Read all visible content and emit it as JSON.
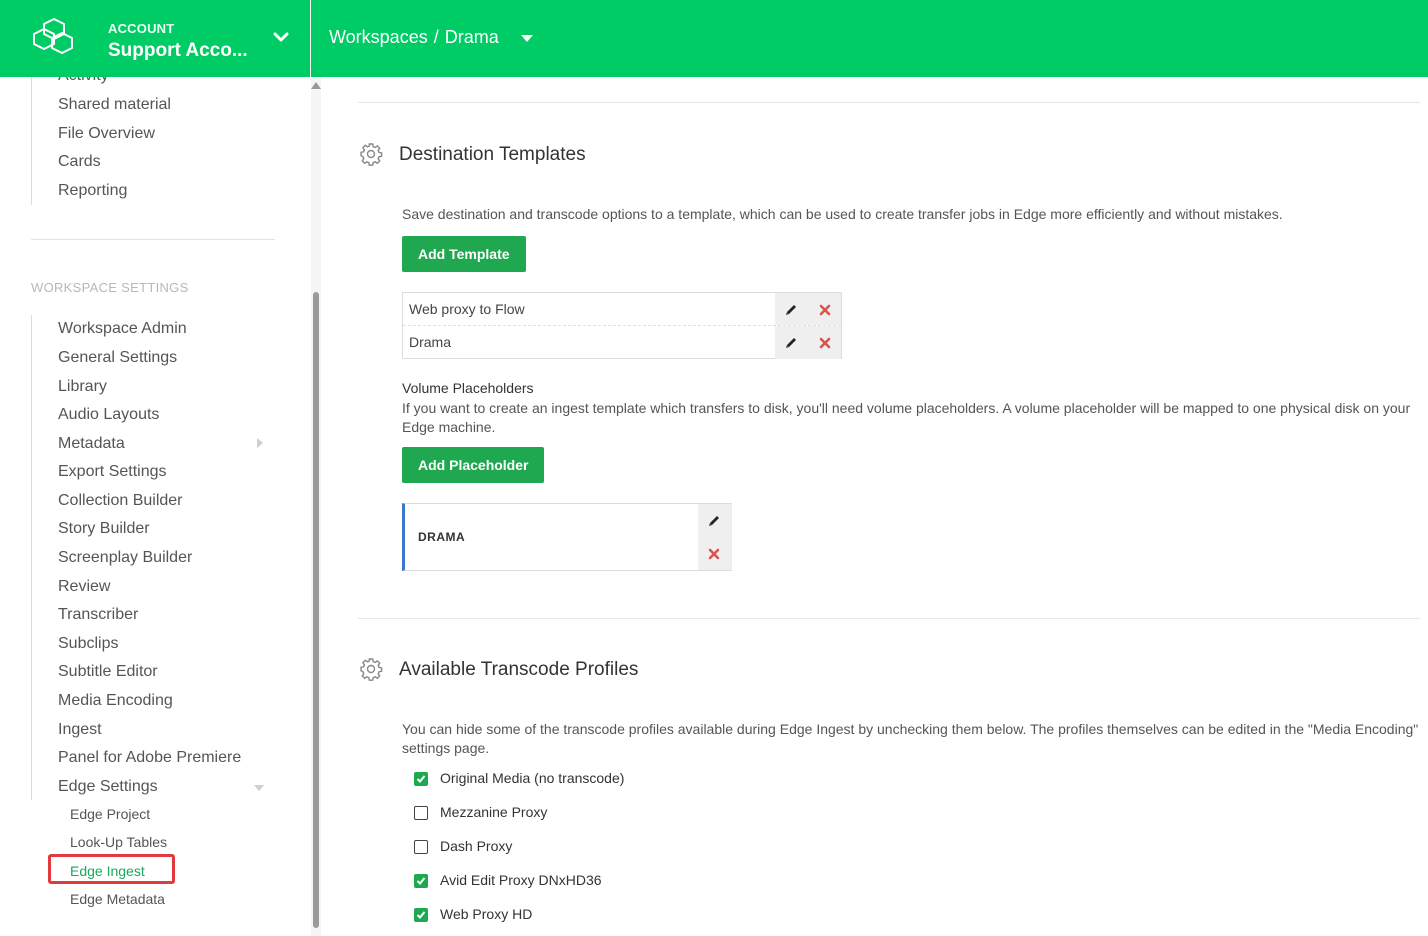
{
  "header": {
    "account_label": "ACCOUNT",
    "account_name": "Support Acco...",
    "breadcrumb_root": "Workspaces",
    "breadcrumb_sep": "/",
    "breadcrumb_current": "Drama"
  },
  "sidebar": {
    "top_items": [
      "Activity",
      "Shared material",
      "File Overview",
      "Cards",
      "Reporting"
    ],
    "section_heading": "WORKSPACE SETTINGS",
    "items": [
      "Workspace Admin",
      "General Settings",
      "Library",
      "Audio Layouts",
      "Metadata",
      "Export Settings",
      "Collection Builder",
      "Story Builder",
      "Screenplay Builder",
      "Review",
      "Transcriber",
      "Subclips",
      "Subtitle Editor",
      "Media Encoding",
      "Ingest",
      "Panel for Adobe Premiere",
      "Edge Settings"
    ],
    "sub_items": [
      "Edge Project",
      "Look-Up Tables",
      "Edge Ingest",
      "Edge Metadata"
    ],
    "active_sub_item": "Edge Ingest"
  },
  "destination_templates": {
    "title": "Destination Templates",
    "description": "Save destination and transcode options to a template, which can be used to create transfer jobs in Edge more efficiently and without mistakes.",
    "add_button": "Add Template",
    "templates": [
      "Web proxy to Flow",
      "Drama"
    ],
    "volume_title": "Volume Placeholders",
    "volume_description": "If you want to create an ingest template which transfers to disk, you'll need volume placeholders. A volume placeholder will be mapped to one physical disk on your Edge machine.",
    "add_placeholder_button": "Add Placeholder",
    "placeholders": [
      "DRAMA"
    ]
  },
  "transcode_profiles": {
    "title": "Available Transcode Profiles",
    "description": "You can hide some of the transcode profiles available during Edge Ingest by unchecking them below. The profiles themselves can be edited in the \"Media Encoding\" settings page.",
    "profiles": [
      {
        "label": "Original Media (no transcode)",
        "checked": true
      },
      {
        "label": "Mezzanine Proxy",
        "checked": false
      },
      {
        "label": "Dash Proxy",
        "checked": false
      },
      {
        "label": "Avid Edit Proxy DNxHD36",
        "checked": true
      },
      {
        "label": "Web Proxy HD",
        "checked": true
      }
    ]
  },
  "colors": {
    "brand_green": "#00cc66",
    "button_green": "#1fa84f",
    "delete_red": "#d9534f",
    "highlight_red": "#e0393e",
    "placeholder_accent": "#3a78c9"
  },
  "icons": [
    "workspace-logo-icon",
    "chevron-down-icon",
    "caret-down-icon",
    "gear-icon",
    "pencil-icon",
    "delete-x-icon",
    "checkbox-icon"
  ]
}
